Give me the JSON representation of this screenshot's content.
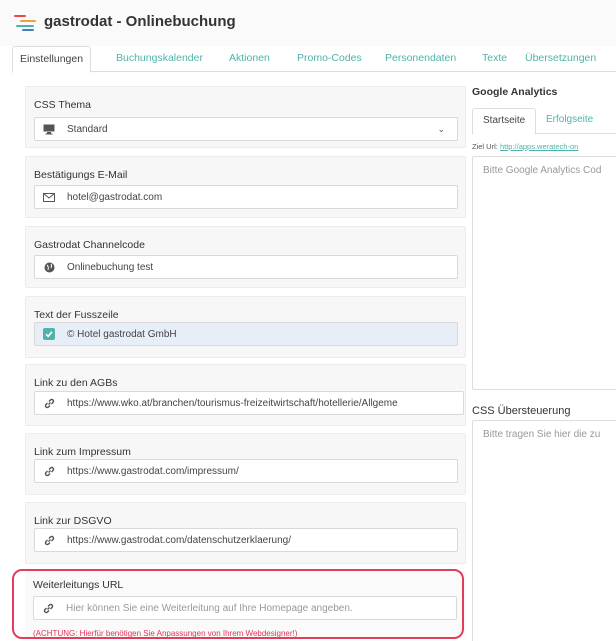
{
  "app": {
    "title": "gastrodat - Onlinebuchung",
    "logo_colors": [
      "#e8474c",
      "#f0a03c",
      "#4fb3a9",
      "#3f7fc4"
    ]
  },
  "tabs": [
    {
      "label": "Einstellungen",
      "active": true
    },
    {
      "label": "Buchungskalender"
    },
    {
      "label": "Aktionen"
    },
    {
      "label": "Promo-Codes"
    },
    {
      "label": "Personendaten"
    },
    {
      "label": "Texte"
    },
    {
      "label": "Übersetzungen"
    }
  ],
  "settings": {
    "css_theme": {
      "label": "CSS Thema",
      "value": "Standard",
      "icon": "monitor-icon"
    },
    "confirm_email": {
      "label": "Bestätigungs E-Mail",
      "value": "hotel@gastrodat.com",
      "icon": "envelope-icon"
    },
    "channelcode": {
      "label": "Gastrodat Channelcode",
      "value": "Onlinebuchung test",
      "icon": "globe-icon"
    },
    "footer_text": {
      "label": "Text der Fusszeile",
      "value": "© Hotel gastrodat GmbH",
      "icon": "checkbox-icon"
    },
    "agb_link": {
      "label": "Link zu den AGBs",
      "value": "https://www.wko.at/branchen/tourismus-freizeitwirtschaft/hotellerie/Allgeme",
      "icon": "link-icon"
    },
    "impressum_link": {
      "label": "Link zum Impressum",
      "value": "https://www.gastrodat.com/impressum/",
      "icon": "link-icon"
    },
    "dsgvo_link": {
      "label": "Link zur DSGVO",
      "value": "https://www.gastrodat.com/datenschutzerklaerung/",
      "icon": "link-icon"
    },
    "redirect_url": {
      "label": "Weiterleitungs URL",
      "placeholder": "Hier können Sie eine Weiterleitung auf Ihre Homepage angeben.",
      "warning": "(ACHTUNG: Hierfür benötigen Sie Anpassungen von Ihrem Webdesigner!)",
      "icon": "link-icon"
    }
  },
  "google_analytics": {
    "title": "Google Analytics",
    "tabs": [
      {
        "label": "Startseite",
        "active": true
      },
      {
        "label": "Erfolgseite"
      }
    ],
    "ziel_label": "Ziel Url:",
    "ziel_url": "http://apps.weratech-on",
    "placeholder": "Bitte Google Analytics Cod"
  },
  "css_override": {
    "title": "CSS Übersteuerung",
    "placeholder": "Bitte tragen Sie hier die zu"
  },
  "colors": {
    "accent": "#4fb3a9",
    "warning": "#e0345a",
    "highlight_outline": "#e23d5c"
  }
}
